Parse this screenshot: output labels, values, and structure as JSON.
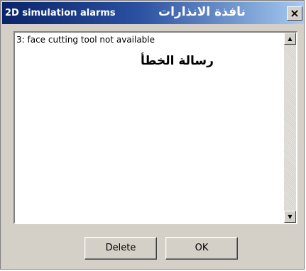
{
  "window": {
    "title": "2D simulation alarms",
    "title_arabic": "نافذة الانذارات",
    "close_label": "×"
  },
  "alarm_list": {
    "items": [
      "3: face cutting tool not available"
    ],
    "annotation_arabic": "رسالة الخطأ"
  },
  "scrollbar": {
    "up_glyph": "▲",
    "down_glyph": "▼"
  },
  "buttons": {
    "delete_label": "Delete",
    "ok_label": "OK"
  }
}
